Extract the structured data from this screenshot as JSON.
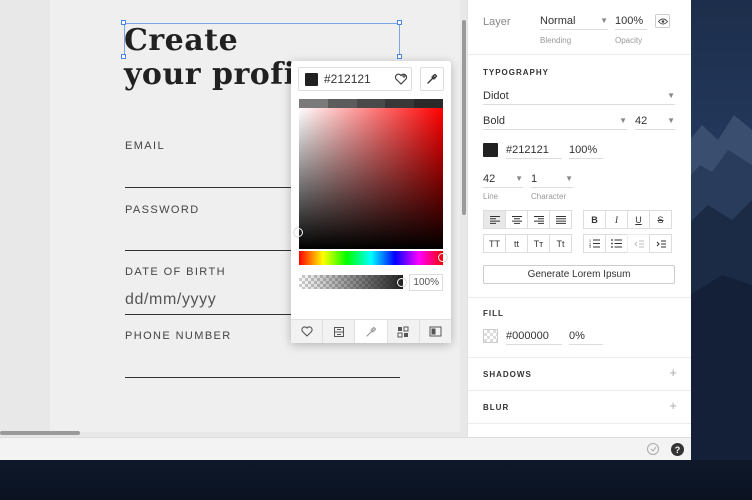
{
  "canvas": {
    "headline_line1": "Create",
    "headline_line2": "your profil",
    "email_label": "EMAIL",
    "password_label": "PASSWORD",
    "dob_label": "DATE OF BIRTH",
    "dob_placeholder": "dd/mm/yyyy",
    "phone_label": "PHONE NUMBER"
  },
  "picker": {
    "hex": "#212121",
    "alpha": "100%",
    "recent_colors": [
      "#7a7a7a",
      "#5c5c5c",
      "#4a4a4a",
      "#383838",
      "#2a2a2a",
      "#212121"
    ],
    "tabs": [
      "heart-icon",
      "panel-icon",
      "eyedropper-icon",
      "grid-icon",
      "toggle-icon"
    ]
  },
  "inspector": {
    "layer_label": "Layer",
    "blending_value": "Normal",
    "blending_label": "Blending",
    "opacity_value": "100%",
    "opacity_label": "Opacity",
    "typography_title": "TYPOGRAPHY",
    "font_family": "Didot",
    "font_weight": "Bold",
    "font_size": "42",
    "text_color_hex": "#212121",
    "text_color_opacity": "100%",
    "line_value": "42",
    "line_label": "Line",
    "character_value": "1",
    "character_label": "Character",
    "align_buttons": [
      "align-left-icon",
      "align-center-icon",
      "align-right-icon",
      "align-justify-icon"
    ],
    "style_buttons": [
      "B",
      "I",
      "U",
      "S"
    ],
    "case_buttons": [
      "TT",
      "tt",
      "Tт",
      "Tt"
    ],
    "lorem_button": "Generate Lorem Ipsum",
    "fill_title": "FILL",
    "fill_hex": "#000000",
    "fill_opacity": "0%",
    "shadows_title": "SHADOWS",
    "blur_title": "BLUR"
  },
  "colors": {
    "text": "#212121",
    "accent": "#4a86e0"
  }
}
